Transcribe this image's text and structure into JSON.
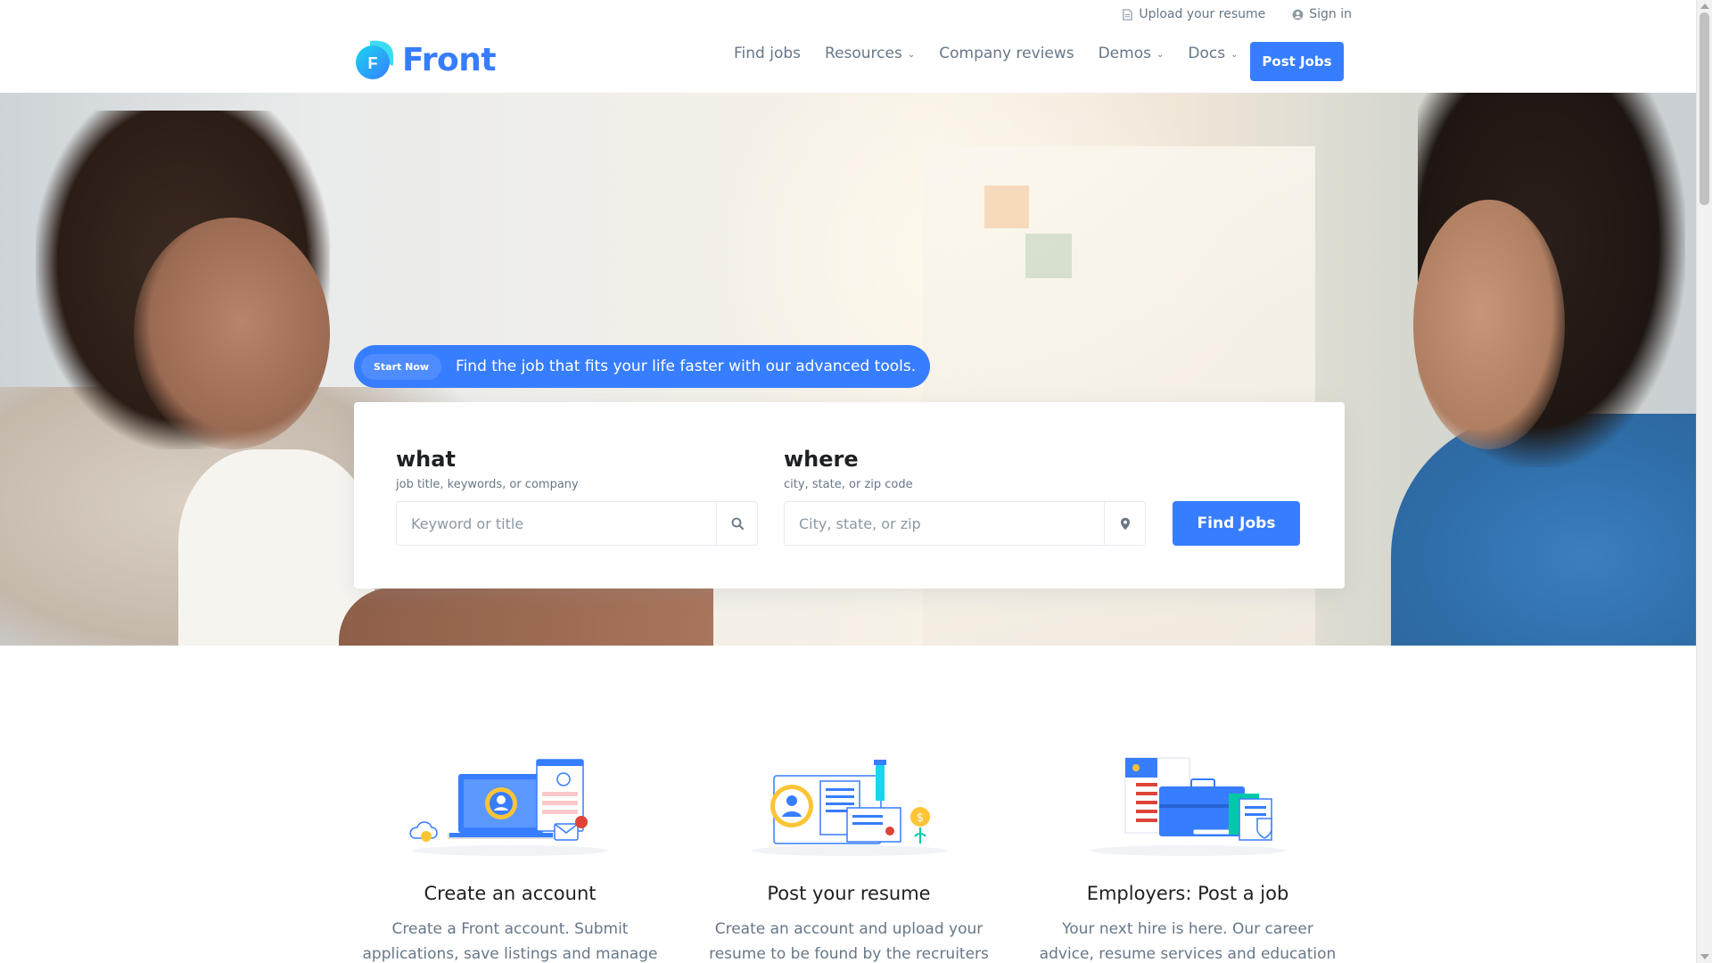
{
  "topbar": {
    "upload_label": "Upload your resume",
    "signin_label": "Sign in"
  },
  "brand": {
    "name": "Front",
    "logo_letter": "F",
    "accent_color": "#377dff"
  },
  "nav": {
    "items": [
      {
        "label": "Find jobs",
        "has_dropdown": false
      },
      {
        "label": "Resources",
        "has_dropdown": true
      },
      {
        "label": "Company reviews",
        "has_dropdown": false
      },
      {
        "label": "Demos",
        "has_dropdown": true
      },
      {
        "label": "Docs",
        "has_dropdown": true
      }
    ],
    "post_jobs_label": "Post Jobs"
  },
  "hero": {
    "badge_label": "Start Now",
    "tagline": "Find the job that fits your life faster with our advanced tools."
  },
  "search": {
    "what": {
      "label": "what",
      "hint": "job title, keywords, or company",
      "placeholder": "Keyword or title",
      "icon": "search-icon"
    },
    "where": {
      "label": "where",
      "hint": "city, state, or zip code",
      "placeholder": "City, state, or zip",
      "icon": "map-pin-icon"
    },
    "submit_label": "Find Jobs"
  },
  "features": [
    {
      "title": "Create an account",
      "description": "Create a Front account. Submit applications, save listings and manage",
      "icon": "create-account-illustration"
    },
    {
      "title": "Post your resume",
      "description": "Create an account and upload your resume to be found by the recruiters who",
      "icon": "post-resume-illustration"
    },
    {
      "title": "Employers: Post a job",
      "description": "Your next hire is here. Our career advice, resume services and education partners",
      "icon": "post-job-illustration"
    }
  ]
}
